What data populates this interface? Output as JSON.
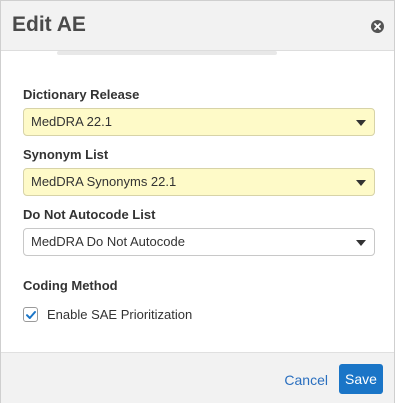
{
  "dialog": {
    "title": "Edit AE"
  },
  "form": {
    "dictionary_release": {
      "label": "Dictionary Release",
      "value": "MedDRA 22.1"
    },
    "synonym_list": {
      "label": "Synonym List",
      "value": "MedDRA Synonyms 22.1"
    },
    "do_not_autocode_list": {
      "label": "Do Not Autocode List",
      "value": "MedDRA Do Not Autocode"
    },
    "coding_method": {
      "label": "Coding Method",
      "checkbox_label": "Enable SAE Prioritization",
      "checked": true
    }
  },
  "footer": {
    "cancel_label": "Cancel",
    "save_label": "Save"
  },
  "colors": {
    "highlight_field": "#fefac8",
    "primary_button": "#1a75c7",
    "link": "#2a6fbf"
  },
  "icons": {
    "close": "close-icon",
    "dropdown": "chevron-down-icon",
    "checkbox": "check-icon"
  }
}
